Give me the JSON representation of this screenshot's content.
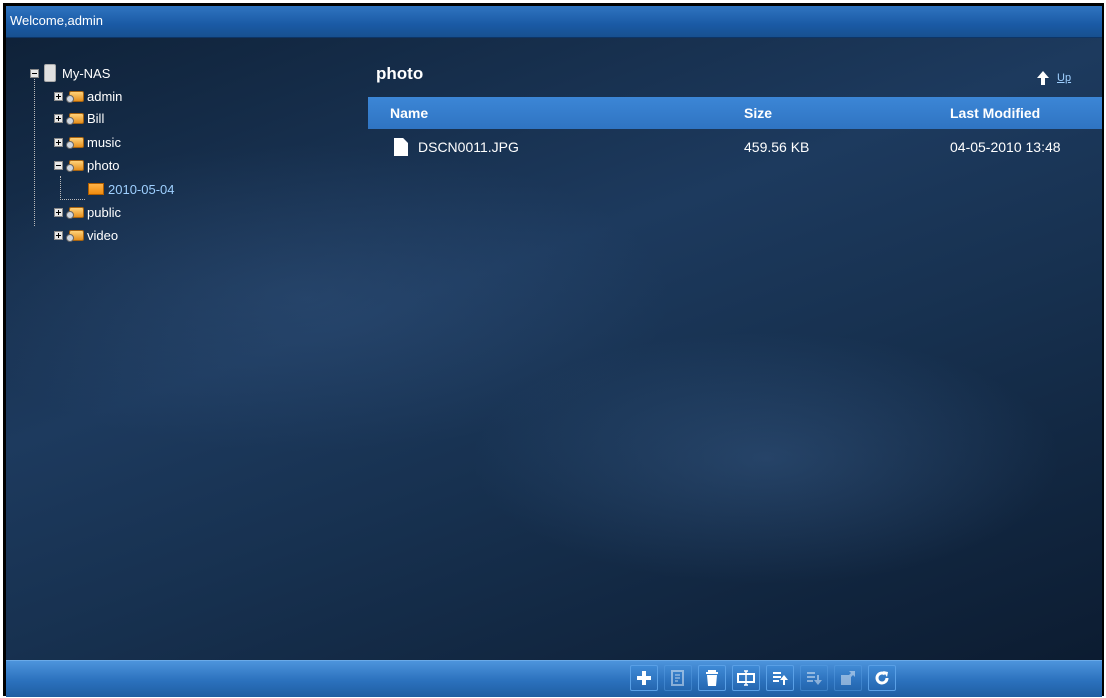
{
  "header": {
    "welcome_text": "Welcome,admin"
  },
  "tree": {
    "root": {
      "label": "My-NAS",
      "icon": "nas-device-icon"
    },
    "shares": [
      {
        "label": "admin",
        "icon": "share-folder-icon",
        "expanded": false
      },
      {
        "label": "Bill",
        "icon": "share-folder-icon",
        "expanded": false
      },
      {
        "label": "music",
        "icon": "share-folder-icon",
        "expanded": false
      },
      {
        "label": "photo",
        "icon": "share-folder-icon",
        "expanded": true
      },
      {
        "label": "public",
        "icon": "share-folder-icon",
        "expanded": false
      },
      {
        "label": "video",
        "icon": "share-folder-icon",
        "expanded": false
      }
    ],
    "selected_child": {
      "label": "2010-05-04",
      "icon": "folder-icon"
    }
  },
  "content": {
    "folder_title": "photo",
    "up_label": "Up",
    "columns": {
      "name": "Name",
      "size": "Size",
      "modified": "Last Modified"
    },
    "files": [
      {
        "name": "DSCN0011.JPG",
        "size": "459.56 KB",
        "modified": "04-05-2010 13:48",
        "icon": "file-icon"
      }
    ]
  },
  "toolbar": {
    "buttons": [
      {
        "name": "add-button",
        "icon": "plus-icon",
        "enabled": true
      },
      {
        "name": "edit-button",
        "icon": "edit-icon",
        "enabled": false
      },
      {
        "name": "delete-button",
        "icon": "trash-icon",
        "enabled": true
      },
      {
        "name": "rename-button",
        "icon": "rename-icon",
        "enabled": true
      },
      {
        "name": "upload-button",
        "icon": "upload-icon",
        "enabled": true
      },
      {
        "name": "download-button",
        "icon": "download-icon",
        "enabled": false
      },
      {
        "name": "move-button",
        "icon": "move-icon",
        "enabled": false
      },
      {
        "name": "refresh-button",
        "icon": "refresh-icon",
        "enabled": true
      }
    ]
  },
  "colors": {
    "header_bar": "#1a5aa5",
    "table_header": "#3580cf",
    "background": "#1b3556",
    "link": "#9fd0ff"
  }
}
